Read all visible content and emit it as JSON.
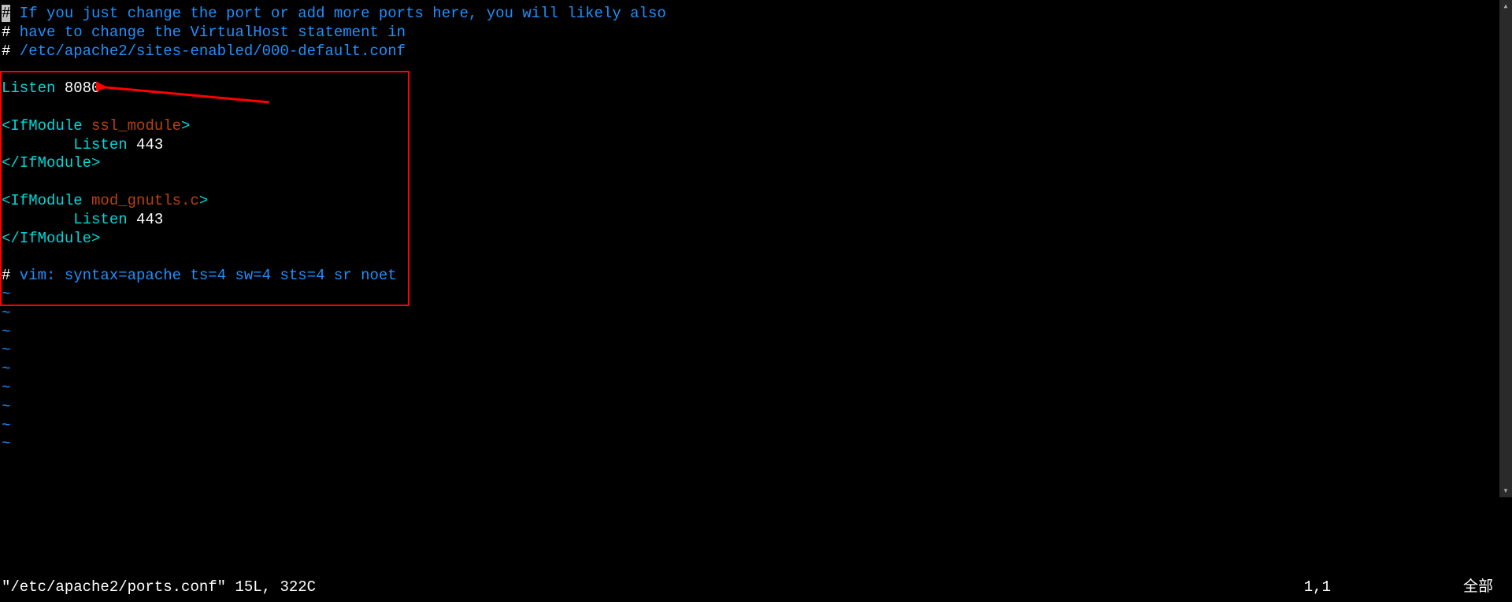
{
  "lines": {
    "l1_hash": "#",
    "l1_rest": " If you just change the port or add more ports here, you will likely also",
    "l2_hash": "#",
    "l2_rest": " have to change the VirtualHost statement in",
    "l3_hash": "#",
    "l3_rest": " /etc/apache2/sites-enabled/000-default.conf",
    "blank": "",
    "listen": "Listen",
    "port8080": " 8080",
    "ifmod_open1_a": "<",
    "ifmod_open1_b": "IfModule",
    "ifmod_open1_c": " ssl_module",
    "ifmod_open1_d": ">",
    "listen443": " 443",
    "ifmod_close_a": "</",
    "ifmod_close_b": "IfModule",
    "ifmod_close_c": ">",
    "ifmod_open2_c": " mod_gnutls.c",
    "vim_hash": "#",
    "vim_rest": " vim: syntax=apache ts=4 sw=4 sts=4 sr noet",
    "tilde": "~",
    "indent": "        "
  },
  "status": {
    "file": "\"/etc/apache2/ports.conf\" 15L, 322C",
    "pos": "1,1",
    "extent": "全部"
  },
  "scroll": {
    "up": "▴",
    "down": "▾"
  }
}
